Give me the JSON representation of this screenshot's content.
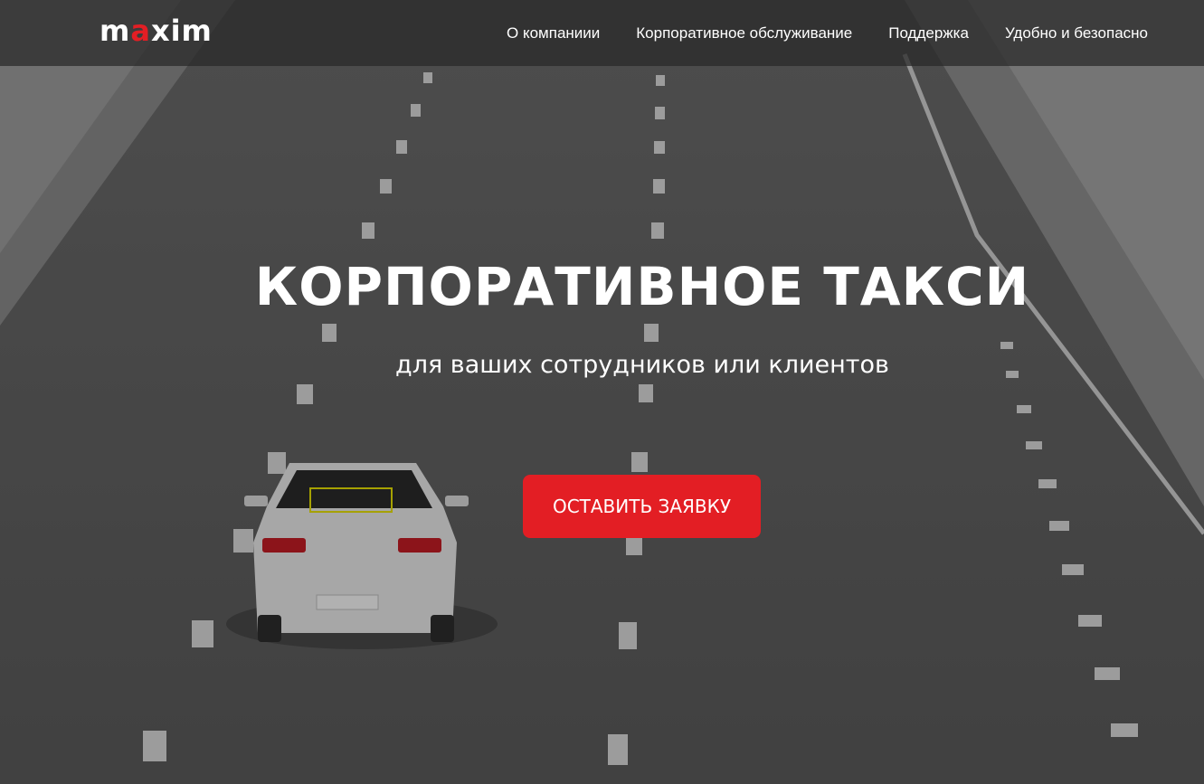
{
  "header": {
    "logo": {
      "text_before": "m",
      "text_accent": "a",
      "text_after": "xim"
    },
    "nav": [
      {
        "label": "О компаниии"
      },
      {
        "label": "Корпоративное обслуживание"
      },
      {
        "label": "Поддержка"
      },
      {
        "label": "Удобно и безопасно"
      }
    ]
  },
  "hero": {
    "title": "КОРПОРАТИВНОЕ ТАКСИ",
    "subtitle": "для ваших сотрудников или клиентов",
    "cta_label": "ОСТАВИТЬ ЗАЯВКУ"
  },
  "colors": {
    "accent": "#e31e24",
    "header_bg": "#282828",
    "text": "#ffffff"
  }
}
